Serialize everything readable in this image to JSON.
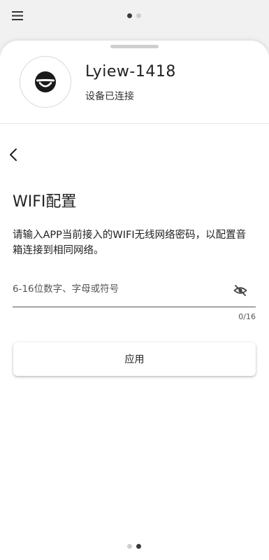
{
  "header": {
    "pager_count": 2,
    "pager_active": 1
  },
  "device": {
    "name": "Lyiew-1418",
    "status": "设备已连接"
  },
  "wifi_config": {
    "title": "WIFI配置",
    "description": "请输入APP当前接入的WIFI无线网络密码，以配置音箱连接到相同网络。",
    "password_placeholder": "6-16位数字、字母或符号",
    "password_value": "",
    "char_counter": "0/16",
    "apply_label": "应用"
  },
  "footer": {
    "pager_count": 2,
    "pager_active": 2
  },
  "icons": {
    "menu": "menu-icon",
    "device_logo": "smiley-logo-icon",
    "back": "chevron-left-icon",
    "visibility": "visibility-off-icon"
  },
  "colors": {
    "accent_dark": "#3a3a3a",
    "dot_inactive": "#cfcfcf",
    "background_gray": "#f1f1f1"
  }
}
